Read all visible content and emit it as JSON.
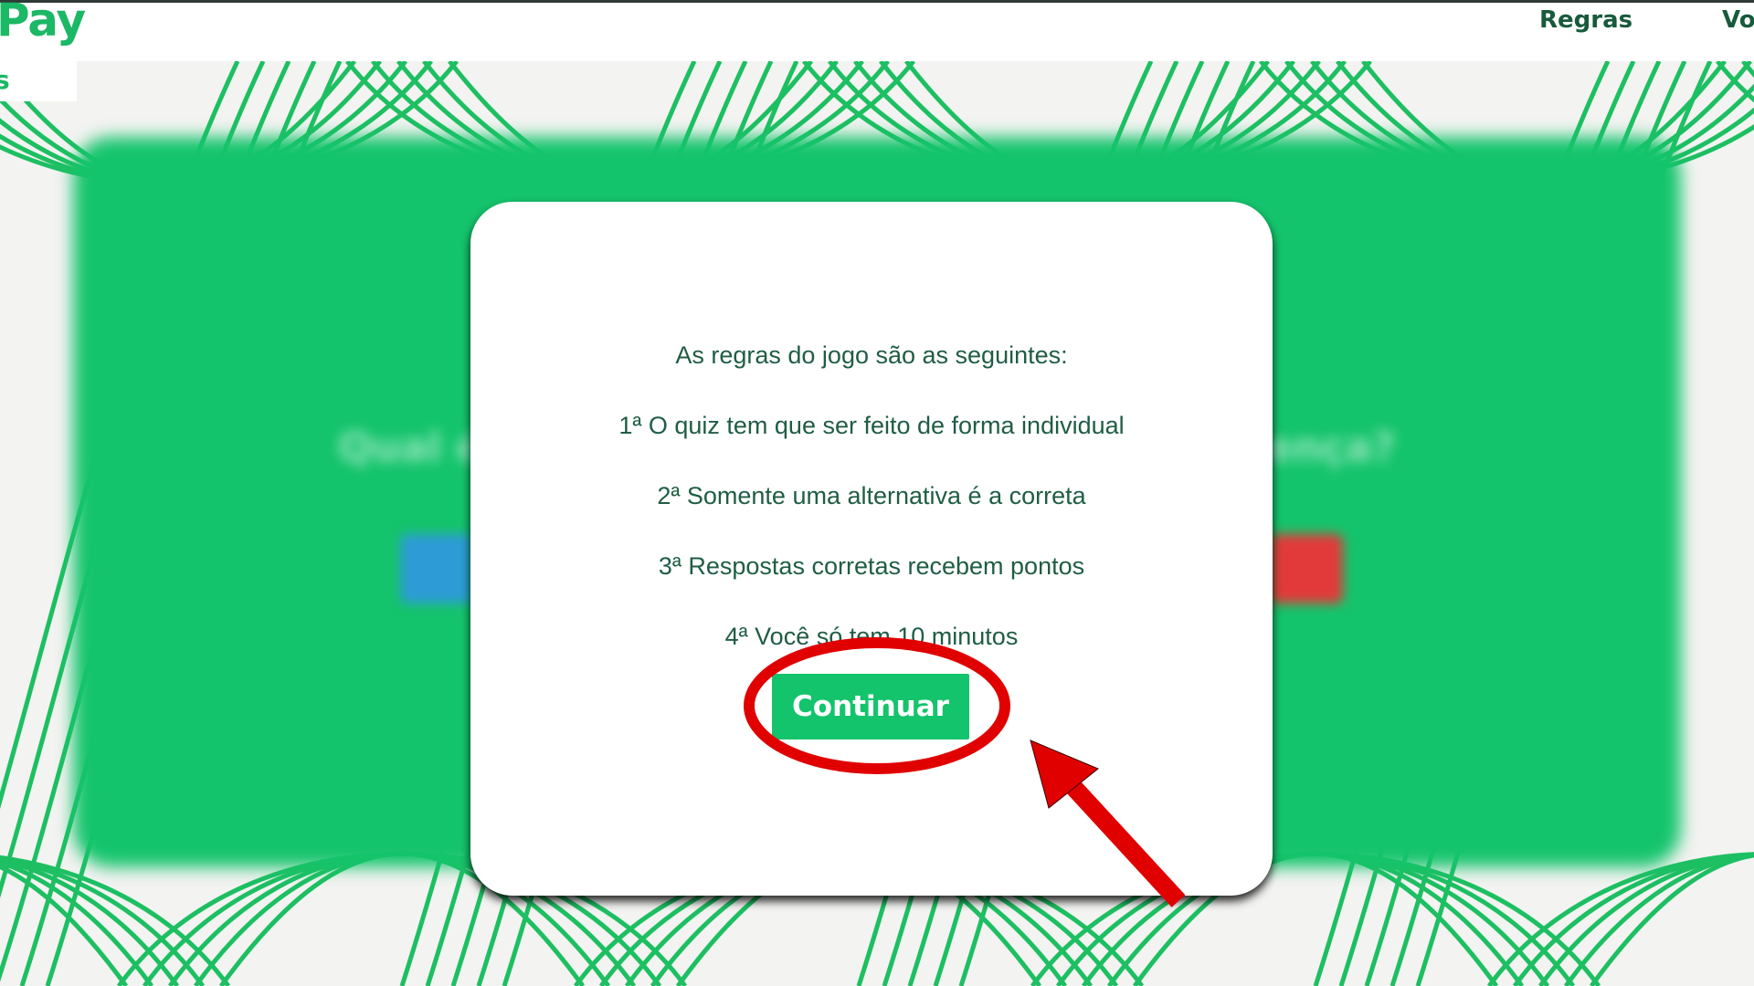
{
  "header": {
    "logo_text": "Pay",
    "logo_sub_text": "s",
    "nav": [
      {
        "label": "Regras"
      },
      {
        "label": "Vo"
      }
    ]
  },
  "background_quiz": {
    "question_fragment_left": "Qual é",
    "question_fragment_right": "ença?"
  },
  "modal": {
    "intro": "As regras do jogo são as seguintes:",
    "rules": [
      "1ª O quiz tem que ser feito de forma individual",
      "2ª Somente uma alternativa é a correta",
      "3ª Respostas corretas recebem pontos",
      "4ª Você só tem 10 minutos"
    ],
    "continue_label": "Continuar"
  },
  "colors": {
    "brand_green": "#14c46c",
    "dark_green_text": "#1f5d44",
    "annotation_red": "#e00000"
  }
}
